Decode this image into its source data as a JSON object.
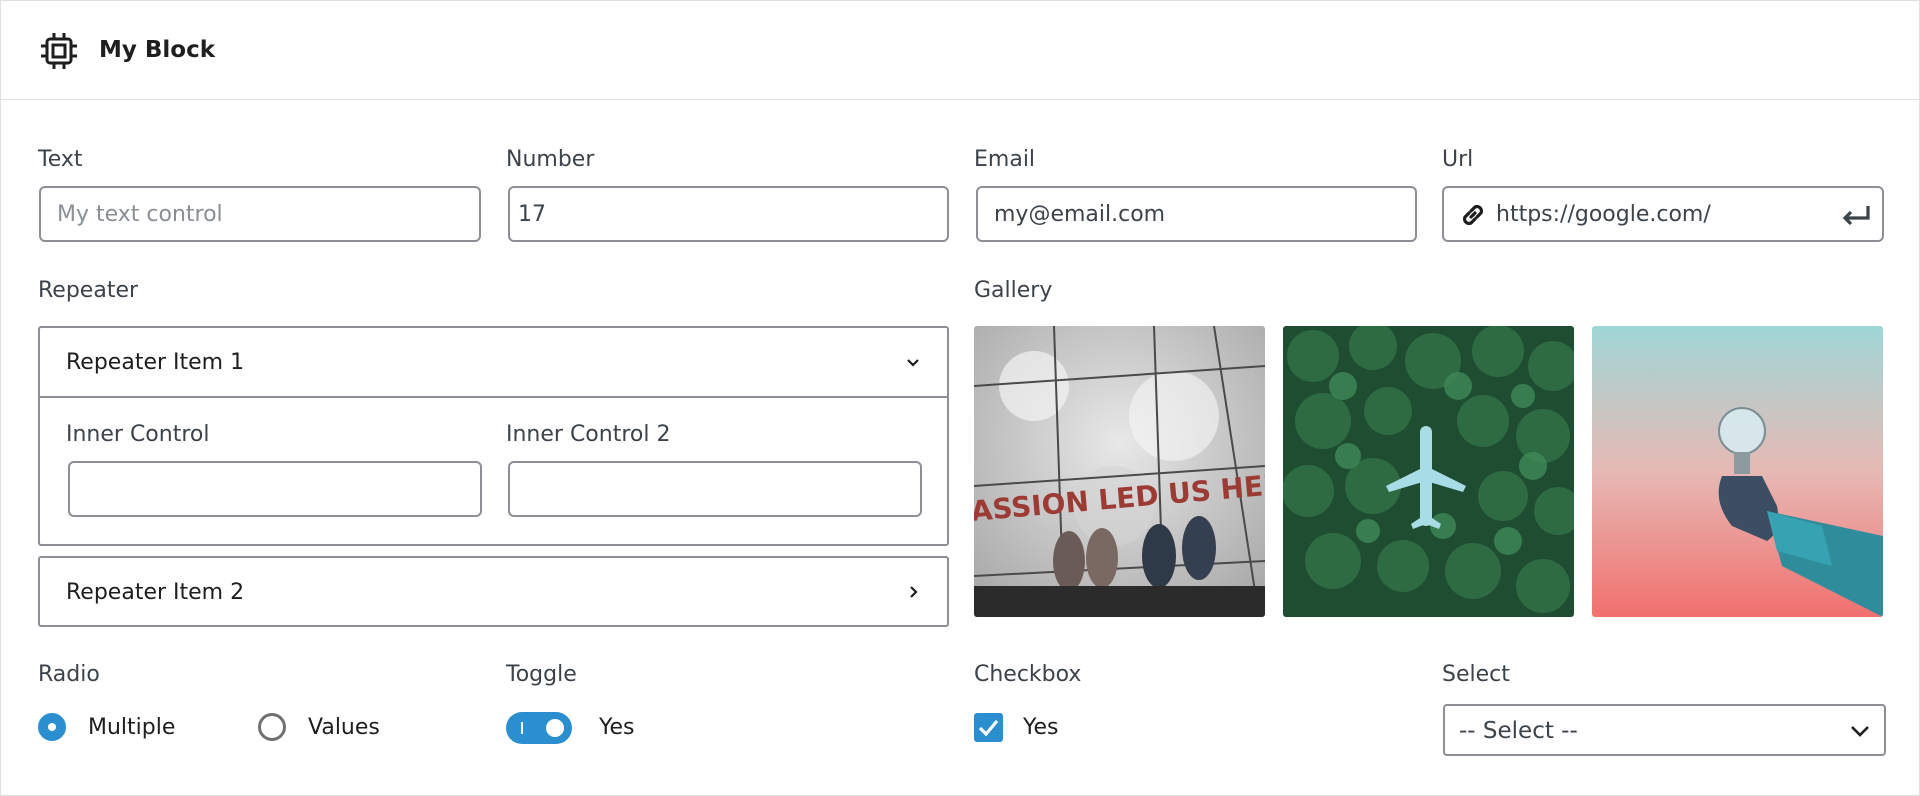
{
  "header": {
    "title": "My Block",
    "icon": "chip-icon"
  },
  "fields": {
    "text": {
      "label": "Text",
      "placeholder": "My text control",
      "value": ""
    },
    "number": {
      "label": "Number",
      "value": "17"
    },
    "email": {
      "label": "Email",
      "value": "my@email.com"
    },
    "url": {
      "label": "Url",
      "value": "https://google.com/"
    }
  },
  "repeater": {
    "label": "Repeater",
    "items": [
      {
        "title": "Repeater Item 1",
        "expanded": true,
        "inner_controls": [
          {
            "label": "Inner Control",
            "value": ""
          },
          {
            "label": "Inner Control 2",
            "value": ""
          }
        ]
      },
      {
        "title": "Repeater Item 2",
        "expanded": false
      }
    ]
  },
  "gallery": {
    "label": "Gallery",
    "images": [
      "sidewalk-shoes-image",
      "forest-airplane-image",
      "lightbulb-hand-image"
    ],
    "image_text": "ASSION LED US HER"
  },
  "radio": {
    "label": "Radio",
    "options": [
      "Multiple",
      "Values"
    ],
    "selected": "Multiple"
  },
  "toggle": {
    "label": "Toggle",
    "on": true,
    "text": "Yes"
  },
  "checkbox": {
    "label": "Checkbox",
    "checked": true,
    "text": "Yes"
  },
  "select": {
    "label": "Select",
    "value": "-- Select --"
  },
  "colors": {
    "accent": "#2b8fcf",
    "border": "#8c8f94",
    "text": "#1e1e1e",
    "label": "#3c434a"
  }
}
